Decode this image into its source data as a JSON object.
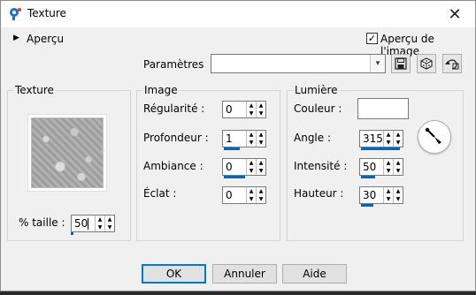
{
  "window": {
    "title": "Texture",
    "close_glyph": "✕"
  },
  "preview_toggle": {
    "arrow": "▶",
    "label": "Aperçu"
  },
  "preview_checkbox": {
    "label": "Aperçu de l'image",
    "checked": true,
    "mark": "✓"
  },
  "presets": {
    "label": "Paramètres",
    "value": "",
    "arrow": "▾"
  },
  "texture_group": {
    "legend": "Texture",
    "size_label": "% taille :",
    "size_value": "50"
  },
  "image_group": {
    "legend": "Image",
    "fields": [
      {
        "label": "Régularité :",
        "value": "0"
      },
      {
        "label": "Profondeur :",
        "value": "1"
      },
      {
        "label": "Ambiance :",
        "value": "0"
      },
      {
        "label": "Éclat :",
        "value": "0"
      }
    ]
  },
  "light_group": {
    "legend": "Lumière",
    "color_label": "Couleur :",
    "color_value": "#ffffff",
    "fields": [
      {
        "label": "Angle :",
        "value": "315"
      },
      {
        "label": "Intensité :",
        "value": "50"
      },
      {
        "label": "Hauteur :",
        "value": "30"
      }
    ]
  },
  "buttons": {
    "ok": "OK",
    "cancel": "Annuler",
    "help": "Aide"
  },
  "colors": {
    "accent": "#0067c0",
    "app_icon": "#1f6fd1"
  },
  "icons": [
    "app-icon",
    "close-icon",
    "save-icon",
    "random-icon",
    "reset-icon"
  ]
}
